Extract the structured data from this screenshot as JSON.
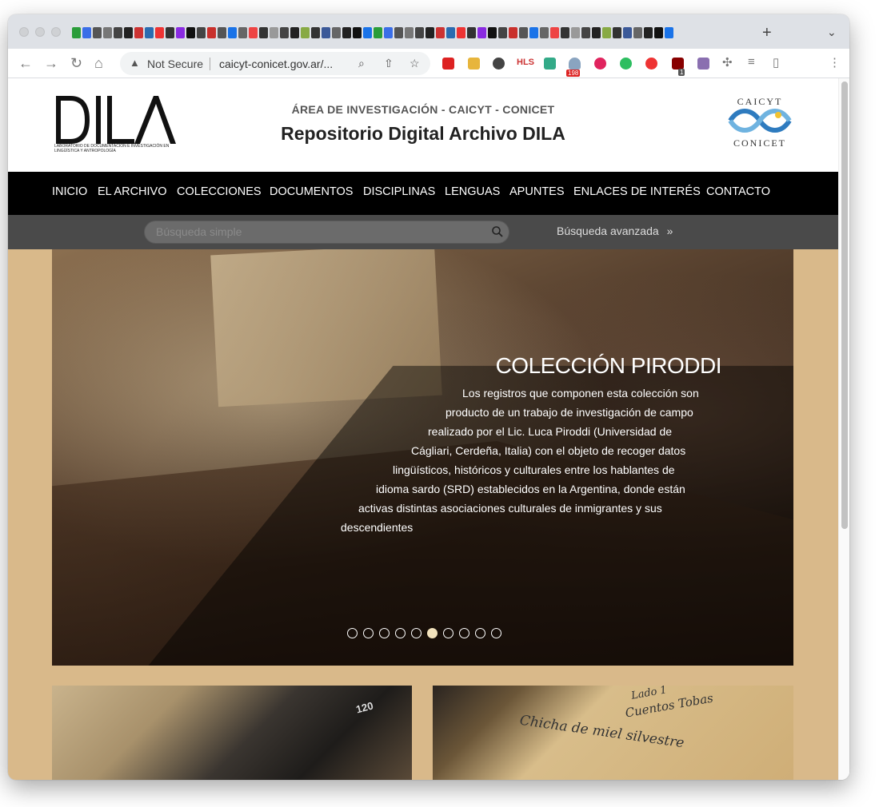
{
  "browser": {
    "omnibox": {
      "security_label": "Not Secure",
      "url": "caicyt-conicet.gov.ar/..."
    },
    "extension_badges": {
      "mail_count": "198",
      "ublock_count": "1"
    }
  },
  "site": {
    "area": "ÁREA DE INVESTIGACIÓN - CAICYT - CONICET",
    "title": "Repositorio Digital Archivo DILA",
    "logo_text": "DILA",
    "logo_subtitle": "Laboratorio de Documentación e Investigación en Lingüística y Antropología",
    "caicyt_top": "CAICYT",
    "caicyt_bottom": "CONICET"
  },
  "nav": {
    "items": [
      {
        "label": "INICIO"
      },
      {
        "label": "EL ARCHIVO"
      },
      {
        "label": "COLECCIONES"
      },
      {
        "label": "DOCUMENTOS"
      },
      {
        "label": "DISCIPLINAS"
      },
      {
        "label": "LENGUAS"
      },
      {
        "label": "APUNTES"
      },
      {
        "label": "ENLACES DE INTERÉS"
      },
      {
        "label": "CONTACTO"
      }
    ]
  },
  "search": {
    "placeholder": "Búsqueda simple",
    "advanced_label": "Búsqueda avanzada",
    "advanced_arrow": "»"
  },
  "slider": {
    "title": "COLECCIÓN PIRODDI",
    "lines": [
      "Los registros que componen esta colección son",
      "producto de un trabajo de investigación de campo",
      "realizado por el Lic. Luca Piroddi (Universidad de",
      "Cágliari, Cerdeña, Italia) con el objeto de recoger datos",
      "lingüísticos, históricos y culturales entre los hablantes de",
      "idioma sardo (SRD) establecidos en la Argentina, donde están",
      "activas distintas asociaciones culturales de inmigrantes y sus",
      "descendientes"
    ],
    "slide_count": 10,
    "active_slide": 6
  },
  "cards": {
    "card1_film_label": "120",
    "card2_handwriting": [
      "Lado 1",
      "Cuentos Tobas",
      "Chicha de miel silvestre"
    ]
  },
  "colors": {
    "page_bg": "#d9b98a",
    "nav_bg": "#000000",
    "search_bg": "#4a4a4a",
    "conicet_blue": "#2e7bbf"
  }
}
